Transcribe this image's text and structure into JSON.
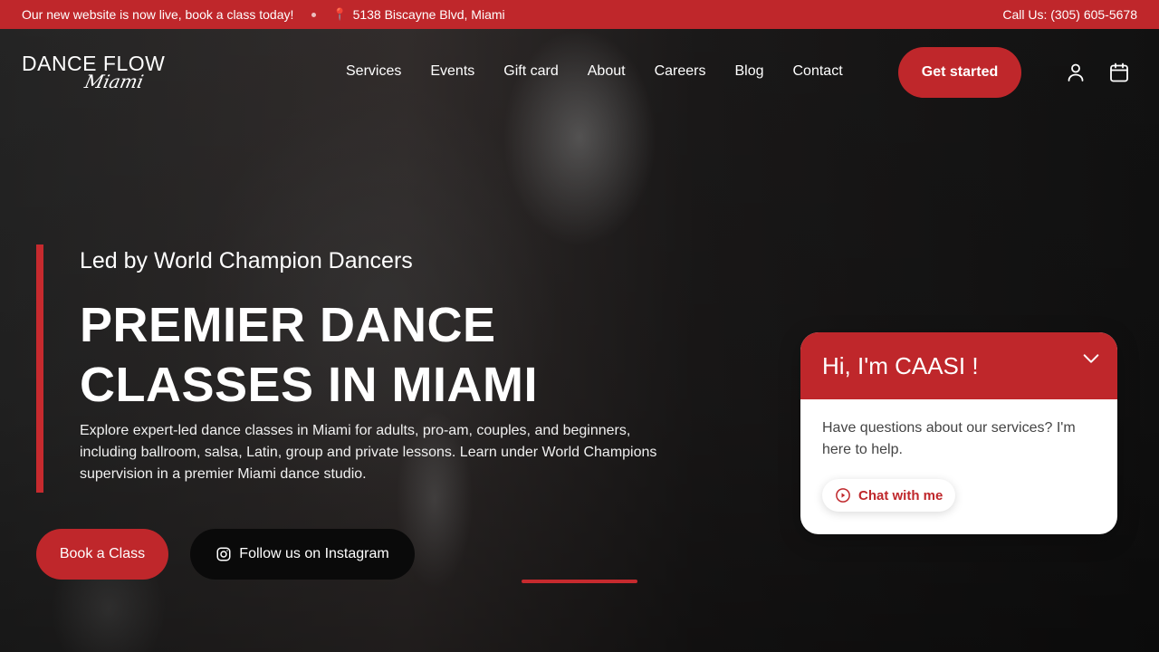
{
  "topbar": {
    "announcement": "Our new website is now live, book a class today!",
    "address": "5138 Biscayne Blvd, Miami",
    "phone": "Call Us: (305) 605-5678"
  },
  "logo": {
    "line1": "DANCE FLOW",
    "line2": "Miami"
  },
  "nav": {
    "items": [
      "Services",
      "Events",
      "Gift card",
      "About",
      "Careers",
      "Blog",
      "Contact"
    ],
    "cta": "Get started"
  },
  "hero": {
    "tagline": "Led by World Champion Dancers",
    "headline_line1": "PREMIER DANCE",
    "headline_line2": "CLASSES IN MIAMI",
    "description": "Explore expert-led dance classes in Miami for adults, pro-am, couples, and beginners, including ballroom, salsa, Latin, group and private lessons. Learn under World Champions supervision in a premier Miami dance studio.",
    "book_label": "Book a Class",
    "instagram_label": "Follow us on Instagram"
  },
  "chat": {
    "title": "Hi, I'm CAASI !",
    "message": "Have questions about our services? I'm here to help.",
    "button_label": "Chat with me"
  },
  "colors": {
    "brand_red": "#bf272b",
    "dark": "#0a0a0a",
    "white": "#ffffff"
  },
  "icons": {
    "location": "map-pin-icon",
    "account": "user-icon",
    "calendar": "calendar-icon",
    "instagram": "instagram-icon",
    "chat_toggle": "chevron-down-icon",
    "chat_play": "play-circle-icon"
  }
}
